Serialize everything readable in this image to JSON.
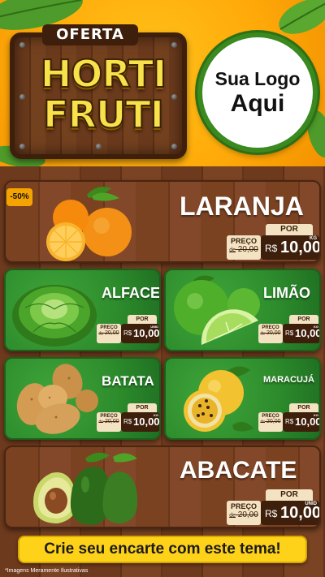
{
  "header": {
    "badge": "OFERTA",
    "title_line1": "HORTI",
    "title_line2": "FRUTI",
    "logo_line1": "Sua Logo",
    "logo_line2": "Aqui"
  },
  "colors": {
    "header_orange": "#ffab0a",
    "wood_brown": "#6e3a1d",
    "card_green": "#2c8a2b",
    "price_dark": "#3d1f0c",
    "cta_yellow": "#ffd21a"
  },
  "discount_badge": "-50%",
  "products": [
    {
      "name": "LARANJA",
      "por": "POR",
      "preco_label": "PREÇO",
      "old_de": "de",
      "old_price": "20,00",
      "currency": "R$",
      "price": "10,00",
      "unit": "KG"
    },
    {
      "name": "ALFACE",
      "por": "POR",
      "preco_label": "PREÇO",
      "old_de": "de",
      "old_price": "20,00",
      "currency": "R$",
      "price": "10,00",
      "unit": "UNID"
    },
    {
      "name": "LIMÃO",
      "por": "POR",
      "preco_label": "PREÇO",
      "old_de": "de",
      "old_price": "20,00",
      "currency": "R$",
      "price": "10,00",
      "unit": "KG"
    },
    {
      "name": "BATATA",
      "por": "POR",
      "preco_label": "PREÇO",
      "old_de": "de",
      "old_price": "20,00",
      "currency": "R$",
      "price": "10,00",
      "unit": "KG"
    },
    {
      "name": "MARACUJÁ",
      "por": "POR",
      "preco_label": "PREÇO",
      "old_de": "de",
      "old_price": "20,00",
      "currency": "R$",
      "price": "10,00",
      "unit": "KG"
    },
    {
      "name": "ABACATE",
      "por": "POR",
      "preco_label": "PREÇO",
      "old_de": "de",
      "old_price": "20,00",
      "currency": "R$",
      "price": "10,00",
      "unit": "UNID"
    }
  ],
  "cta": "Crie seu encarte com este tema!",
  "disclaimer": "*Imagens Meramente Ilustrativas"
}
